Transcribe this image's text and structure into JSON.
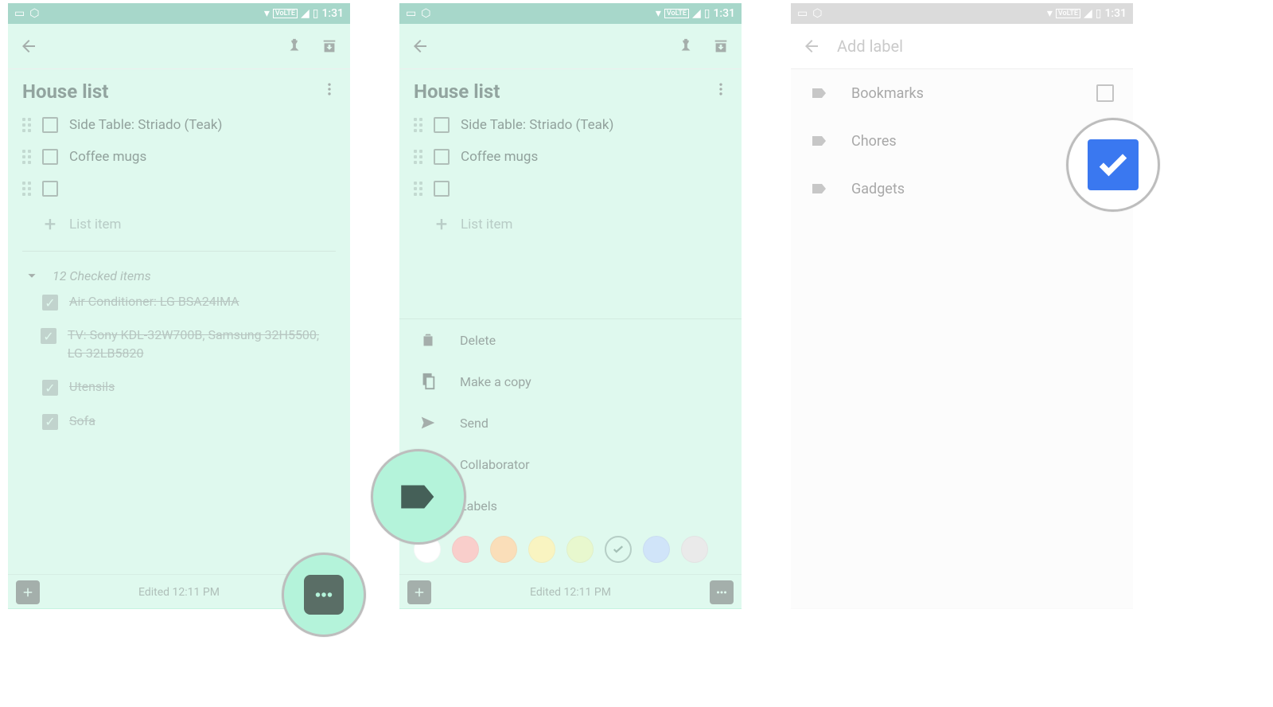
{
  "status": {
    "time": "1:31"
  },
  "note": {
    "title": "House list",
    "items": [
      "Side Table: Striado (Teak)",
      "Coffee mugs"
    ],
    "new_item_placeholder": "List item",
    "checked_header": "12 Checked items",
    "checked_items": [
      "Air Conditioner: LG BSA24IMA",
      "TV: Sony KDL-32W700B, Samsung 32H5500, LG 32LB5820",
      "Utensils",
      "Sofa"
    ],
    "edited": "Edited 12:11 PM"
  },
  "sheet": {
    "delete": "Delete",
    "copy": "Make a copy",
    "send": "Send",
    "collab": "Collaborator",
    "labels": "Labels",
    "colors": [
      "#ffffff",
      "#f4a7a1",
      "#f6c480",
      "#f4ec8f",
      "#d6f2a6",
      "#c5f4e0",
      "#a9cef4",
      "#d9d9d9"
    ],
    "selected_color": 5
  },
  "labels": {
    "placeholder": "Add label",
    "items": [
      "Bookmarks",
      "Chores",
      "Gadgets"
    ],
    "checked_index": 1
  }
}
